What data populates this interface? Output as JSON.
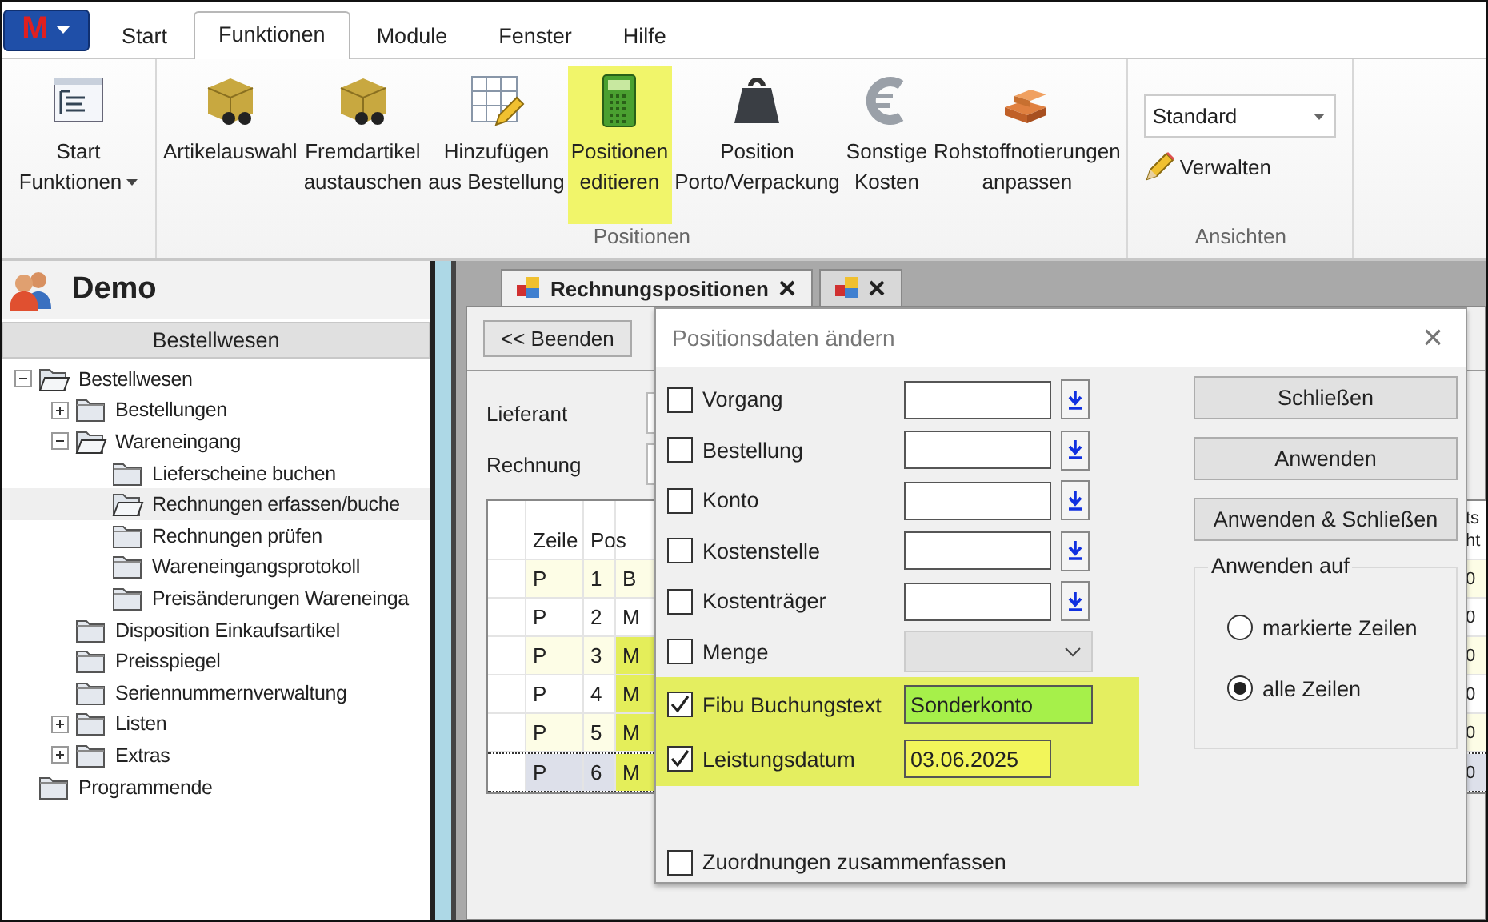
{
  "app_menu": {
    "label": "M"
  },
  "menu_tabs": [
    {
      "label": "Start",
      "selected": false
    },
    {
      "label": "Funktionen",
      "selected": true
    },
    {
      "label": "Module",
      "selected": false
    },
    {
      "label": "Fenster",
      "selected": false
    },
    {
      "label": "Hilfe",
      "selected": false
    }
  ],
  "ribbon": {
    "groups": [
      {
        "items": [
          {
            "lines": [
              "Start",
              "Funktionen"
            ],
            "dropdown": true,
            "highlighted": false
          }
        ]
      },
      {
        "label": "Positionen",
        "items": [
          {
            "lines": [
              "Artikelauswahl"
            ],
            "dropdown": false,
            "highlighted": false
          },
          {
            "lines": [
              "Fremdartikel",
              "austauschen"
            ],
            "dropdown": false,
            "highlighted": false
          },
          {
            "lines": [
              "Hinzufügen",
              "aus Bestellung"
            ],
            "dropdown": false,
            "highlighted": false
          },
          {
            "lines": [
              "Positionen",
              "editieren"
            ],
            "dropdown": false,
            "highlighted": true
          },
          {
            "lines": [
              "Position",
              "Porto/Verpackung"
            ],
            "dropdown": false,
            "highlighted": false
          },
          {
            "lines": [
              "Sonstige",
              "Kosten"
            ],
            "dropdown": false,
            "highlighted": false
          },
          {
            "lines": [
              "Rohstoffnotierungen",
              "anpassen"
            ],
            "dropdown": false,
            "highlighted": false
          }
        ]
      },
      {
        "label": "Ansichten",
        "view_select": "Standard",
        "manage_button": "Verwalten"
      }
    ]
  },
  "sidebar": {
    "title": "Demo",
    "section": "Bestellwesen",
    "tree": [
      {
        "label": "Bestellwesen",
        "expanded": true,
        "selected": false,
        "children": [
          {
            "label": "Bestellungen",
            "expanded": false,
            "selected": false
          },
          {
            "label": "Wareneingang",
            "expanded": true,
            "selected": false,
            "children": [
              {
                "label": "Lieferscheine buchen",
                "selected": false
              },
              {
                "label": "Rechnungen erfassen/buche",
                "selected": true
              },
              {
                "label": "Rechnungen prüfen",
                "selected": false
              },
              {
                "label": "Wareneingangsprotokoll",
                "selected": false
              },
              {
                "label": "Preisänderungen Wareneinga",
                "selected": false
              }
            ]
          },
          {
            "label": "Disposition Einkaufsartikel",
            "selected": false
          },
          {
            "label": "Preisspiegel",
            "selected": false
          },
          {
            "label": "Seriennummernverwaltung",
            "selected": false
          },
          {
            "label": "Listen",
            "expanded": false,
            "selected": false
          },
          {
            "label": "Extras",
            "expanded": false,
            "selected": false
          }
        ]
      },
      {
        "label": "Programmende",
        "selected": false
      }
    ]
  },
  "document_tabs": [
    {
      "label": "Rechnungspositionen",
      "selected": true
    },
    {
      "selected": false
    }
  ],
  "document": {
    "back_button": "<< Beenden",
    "fields": [
      {
        "label": "Lieferant"
      },
      {
        "label": "Rechnung"
      }
    ],
    "grid": {
      "columns": [
        {
          "label": "Zeile"
        },
        {
          "label": "Pos"
        },
        {},
        {
          "lines": [
            "ts",
            "ht"
          ]
        }
      ],
      "rows": [
        {
          "cells": [
            "P",
            "1",
            "B",
            "0"
          ],
          "selected": false,
          "highlighted": false
        },
        {
          "cells": [
            "P",
            "2",
            "M",
            "0"
          ],
          "selected": false,
          "highlighted": false
        },
        {
          "cells": [
            "P",
            "3",
            "M",
            "0"
          ],
          "selected": false,
          "highlighted": true
        },
        {
          "cells": [
            "P",
            "4",
            "M",
            "0"
          ],
          "selected": false,
          "highlighted": true
        },
        {
          "cells": [
            "P",
            "5",
            "M",
            "0"
          ],
          "selected": false,
          "highlighted": true
        },
        {
          "cells": [
            "P",
            "6",
            "M",
            "0"
          ],
          "selected": true,
          "highlighted": true
        }
      ]
    }
  },
  "dialog": {
    "title": "Positionsdaten ändern",
    "close": "×",
    "rows": [
      {
        "label": "Vorgang",
        "kind": "lookup",
        "checked": false,
        "highlighted": false
      },
      {
        "label": "Bestellung",
        "kind": "lookup",
        "checked": false,
        "highlighted": false
      },
      {
        "label": "Konto",
        "kind": "lookup",
        "checked": false,
        "highlighted": false
      },
      {
        "label": "Kostenstelle",
        "kind": "lookup",
        "checked": false,
        "highlighted": false
      },
      {
        "label": "Kostenträger",
        "kind": "lookup",
        "checked": false,
        "highlighted": false
      },
      {
        "label": "Menge",
        "kind": "combo",
        "checked": false,
        "highlighted": false
      },
      {
        "label": "Fibu Buchungstext",
        "kind": "text",
        "value": "Sonderkonto",
        "color": "#a6f04a",
        "checked": true,
        "highlighted": true
      },
      {
        "label": "Leistungsdatum",
        "kind": "date",
        "value": "03.06.2025",
        "color": "#f2f55a",
        "checked": true,
        "highlighted": true
      }
    ],
    "merge": {
      "label": "Zuordnungen zusammenfassen",
      "checked": false
    },
    "buttons": [
      "Schließen",
      "Anwenden",
      "Anwenden & Schließen"
    ],
    "apply_to": {
      "label": "Anwenden auf",
      "options": [
        {
          "label": "markierte Zeilen",
          "selected": false
        },
        {
          "label": "alle Zeilen",
          "selected": true
        }
      ]
    }
  }
}
